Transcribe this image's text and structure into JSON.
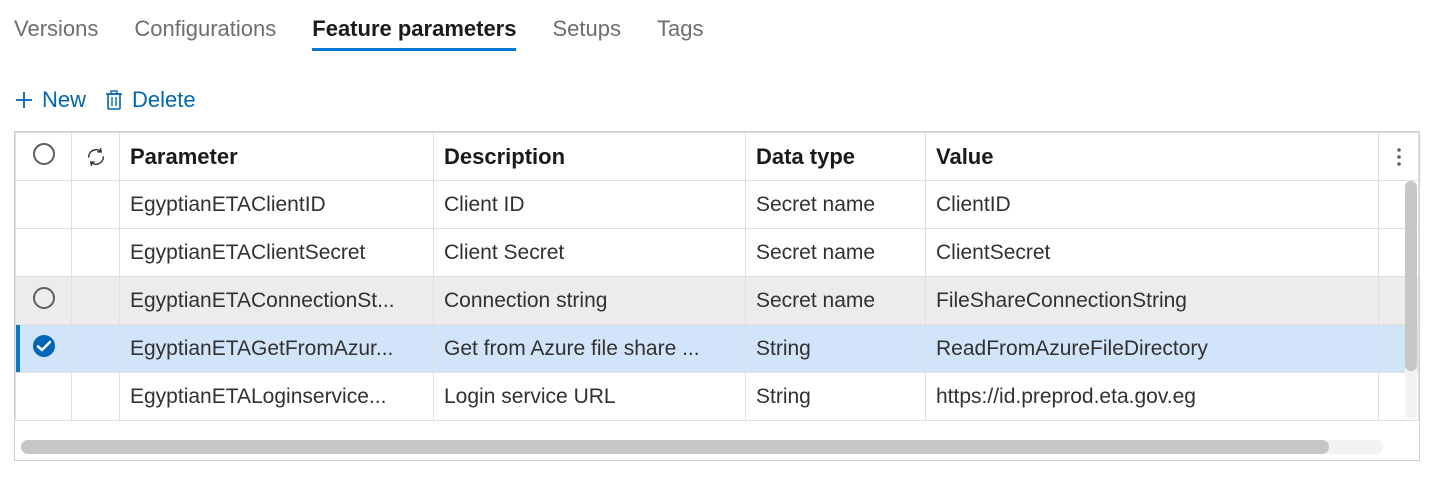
{
  "tabs": [
    {
      "label": "Versions",
      "active": false
    },
    {
      "label": "Configurations",
      "active": false
    },
    {
      "label": "Feature parameters",
      "active": true
    },
    {
      "label": "Setups",
      "active": false
    },
    {
      "label": "Tags",
      "active": false
    }
  ],
  "toolbar": {
    "new_label": "New",
    "delete_label": "Delete"
  },
  "columns": {
    "parameter": "Parameter",
    "description": "Description",
    "data_type": "Data type",
    "value": "Value"
  },
  "rows": [
    {
      "parameter": "EgyptianETAClientID",
      "description": "Client ID",
      "data_type": "Secret name",
      "value": "ClientID",
      "state": "normal"
    },
    {
      "parameter": "EgyptianETAClientSecret",
      "description": "Client Secret",
      "data_type": "Secret name",
      "value": "ClientSecret",
      "state": "normal"
    },
    {
      "parameter": "EgyptianETAConnectionSt...",
      "description": "Connection string",
      "data_type": "Secret name",
      "value": "FileShareConnectionString",
      "state": "hovered"
    },
    {
      "parameter": "EgyptianETAGetFromAzur...",
      "description": "Get from Azure file share ...",
      "data_type": "String",
      "value": "ReadFromAzureFileDirectory",
      "state": "selected"
    },
    {
      "parameter": "EgyptianETALoginservice...",
      "description": "Login service URL",
      "data_type": "String",
      "value": "https://id.preprod.eta.gov.eg",
      "state": "normal"
    }
  ]
}
